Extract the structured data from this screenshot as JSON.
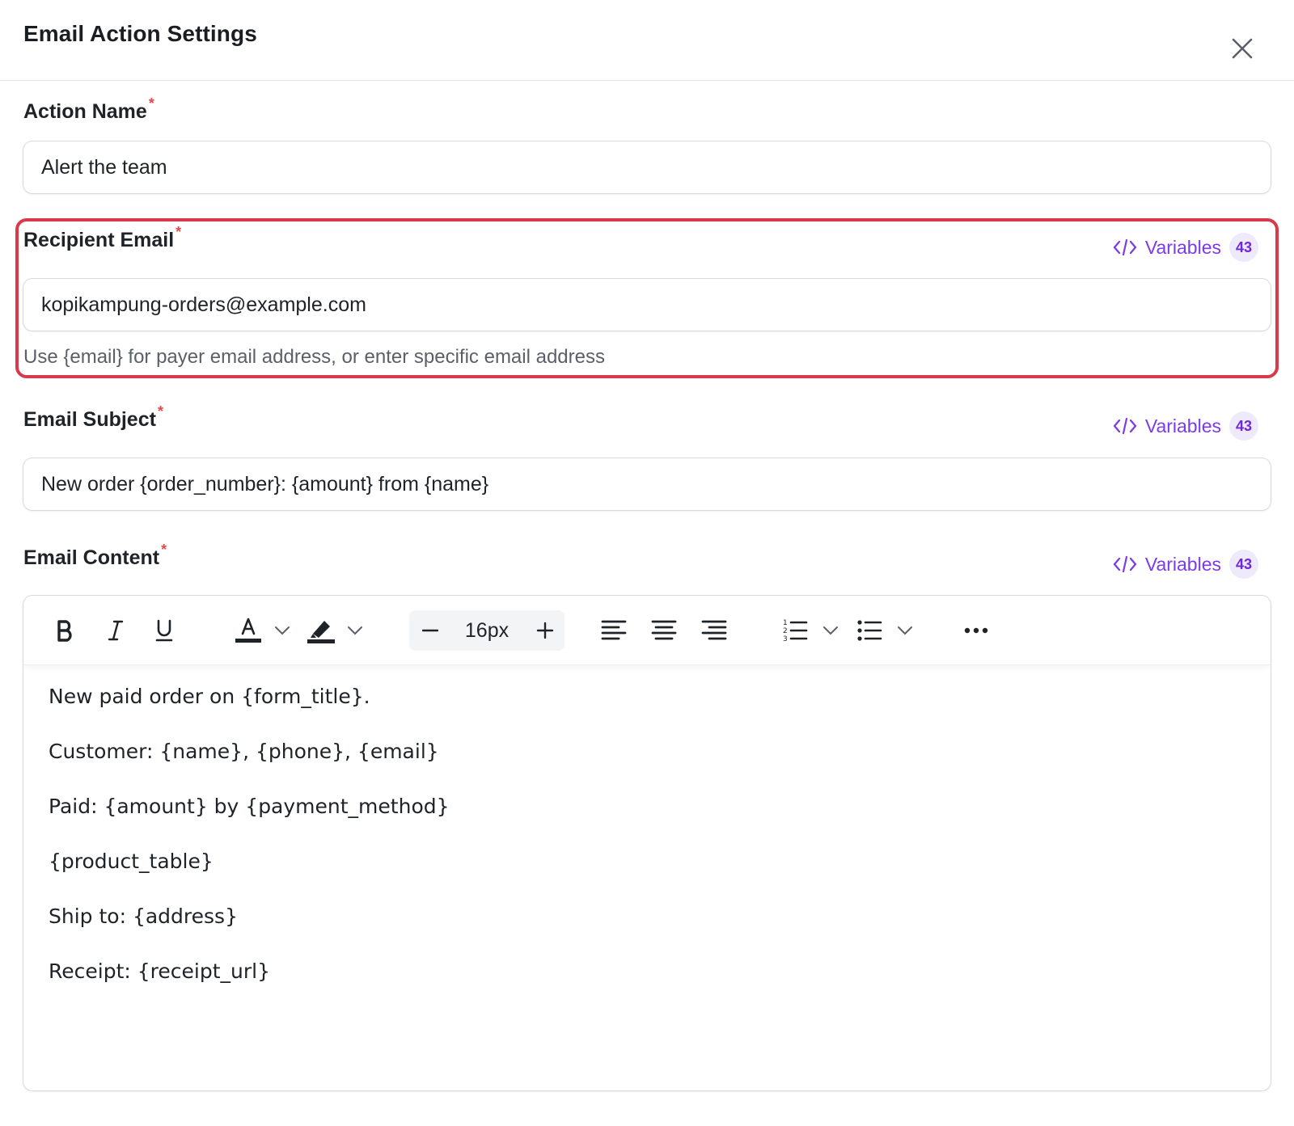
{
  "header": {
    "title": "Email Action Settings",
    "close_icon": "close-icon"
  },
  "action_name": {
    "label": "Action Name",
    "required_mark": "*",
    "value": "Alert the team"
  },
  "recipient_email": {
    "label": "Recipient Email",
    "required_mark": "*",
    "variables_label": "Variables",
    "variables_count": "43",
    "value": "kopikampung-orders@example.com",
    "hint": "Use {email} for payer email address, or enter specific email address",
    "highlight_color": "#d93a4a"
  },
  "email_subject": {
    "label": "Email Subject",
    "required_mark": "*",
    "variables_label": "Variables",
    "variables_count": "43",
    "value": "New order {order_number}: {amount} from {name}"
  },
  "email_content": {
    "label": "Email Content",
    "required_mark": "*",
    "variables_label": "Variables",
    "variables_count": "43",
    "toolbar": {
      "font_size": "16px",
      "icons": [
        "bold-icon",
        "italic-icon",
        "underline-icon",
        "text-color-icon",
        "highlight-icon",
        "minus-icon",
        "plus-icon",
        "align-left-icon",
        "align-center-icon",
        "align-right-icon",
        "ordered-list-icon",
        "bullet-list-icon",
        "more-icon"
      ]
    },
    "lines": [
      "New paid order on {form_title}.",
      "Customer: {name}, {phone}, {email}",
      "Paid: {amount} by {payment_method}",
      "{product_table}",
      "Ship to: {address}",
      "Receipt: {receipt_url}"
    ]
  },
  "colors": {
    "accent": "#7c3aed",
    "required": "#e5484d",
    "border": "#d7dadf"
  }
}
